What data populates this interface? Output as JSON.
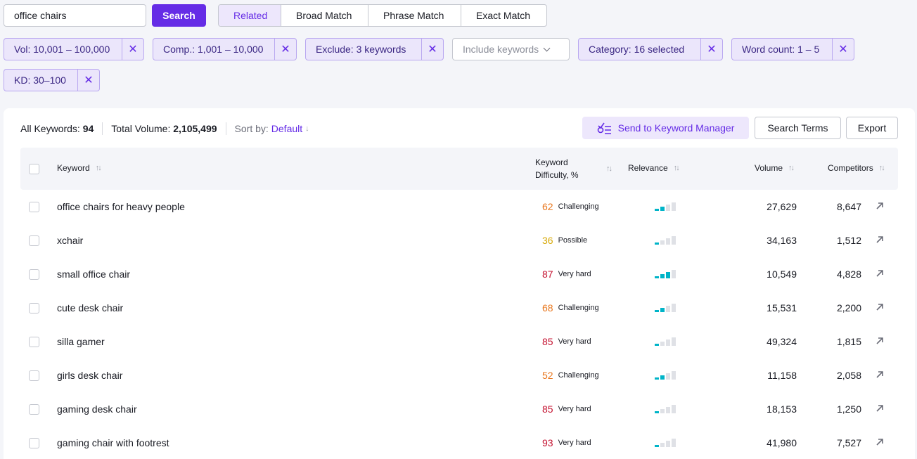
{
  "search": {
    "value": "office chairs",
    "button": "Search"
  },
  "match_tabs": [
    "Related",
    "Broad Match",
    "Phrase Match",
    "Exact Match"
  ],
  "filters": {
    "vol": "Vol: 10,001 – 100,000",
    "comp": "Comp.: 1,001 – 10,000",
    "exclude": "Exclude: 3 keywords",
    "include": "Include keywords",
    "category": "Category: 16 selected",
    "word_count": "Word count: 1 – 5",
    "kd": "KD: 30–100"
  },
  "summary": {
    "all_label": "All Keywords:",
    "all_value": "94",
    "total_label": "Total Volume:",
    "total_value": "2,105,499",
    "sort_label": "Sort by:",
    "sort_value": "Default"
  },
  "actions": {
    "keyword_manager": "Send to Keyword Manager",
    "search_terms": "Search Terms",
    "export": "Export"
  },
  "columns": {
    "keyword": "Keyword",
    "kd_line1": "Keyword",
    "kd_line2": "Difficulty, %",
    "relevance": "Relevance",
    "volume": "Volume",
    "competitors": "Competitors"
  },
  "colors": {
    "accent": "#652ce6",
    "challenging": "#e8771e",
    "possible": "#d7a908",
    "very_hard": "#c41230",
    "relevance_on": "#00b4c8",
    "relevance_off": "#dfe1e6"
  },
  "rows": [
    {
      "keyword": "office chairs for heavy people",
      "kd": "62",
      "kd_label": "Challenging",
      "kd_level": "challenging",
      "relevance": 2,
      "volume": "27,629",
      "competitors": "8,647"
    },
    {
      "keyword": "xchair",
      "kd": "36",
      "kd_label": "Possible",
      "kd_level": "possible",
      "relevance": 1,
      "volume": "34,163",
      "competitors": "1,512"
    },
    {
      "keyword": "small office chair",
      "kd": "87",
      "kd_label": "Very hard",
      "kd_level": "very_hard",
      "relevance": 3,
      "volume": "10,549",
      "competitors": "4,828"
    },
    {
      "keyword": "cute desk chair",
      "kd": "68",
      "kd_label": "Challenging",
      "kd_level": "challenging",
      "relevance": 2,
      "volume": "15,531",
      "competitors": "2,200"
    },
    {
      "keyword": "silla gamer",
      "kd": "85",
      "kd_label": "Very hard",
      "kd_level": "very_hard",
      "relevance": 1,
      "volume": "49,324",
      "competitors": "1,815"
    },
    {
      "keyword": "girls desk chair",
      "kd": "52",
      "kd_label": "Challenging",
      "kd_level": "challenging",
      "relevance": 2,
      "volume": "11,158",
      "competitors": "2,058"
    },
    {
      "keyword": "gaming desk chair",
      "kd": "85",
      "kd_label": "Very hard",
      "kd_level": "very_hard",
      "relevance": 1,
      "volume": "18,153",
      "competitors": "1,250"
    },
    {
      "keyword": "gaming chair with footrest",
      "kd": "93",
      "kd_label": "Very hard",
      "kd_level": "very_hard",
      "relevance": 1,
      "volume": "41,980",
      "competitors": "7,527"
    }
  ]
}
